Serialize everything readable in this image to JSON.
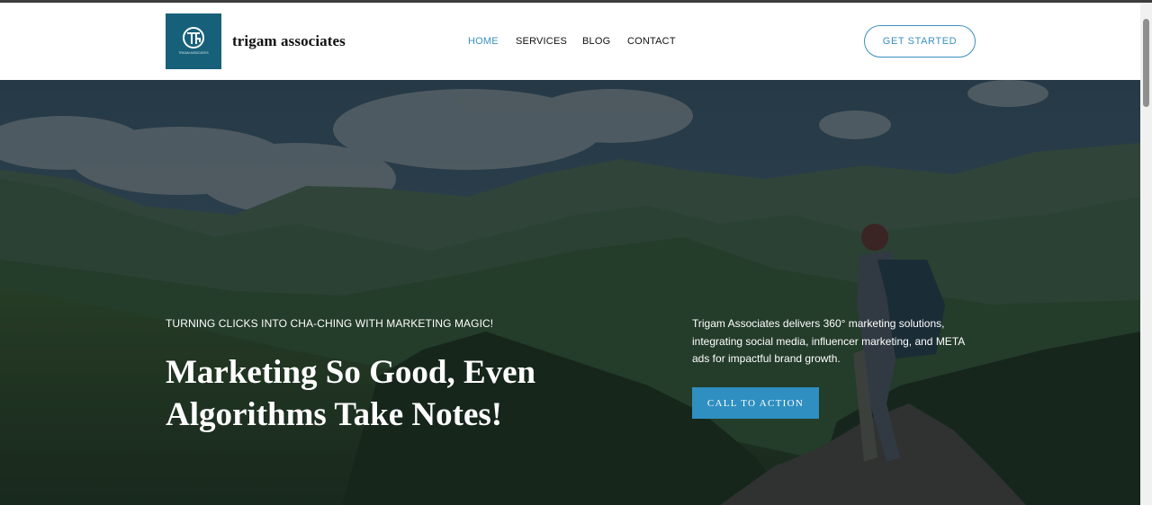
{
  "brand": {
    "name": "trigam associates",
    "logo_caption": "TRIGAM ASSOCIATES",
    "logo_color": "#17607a"
  },
  "nav": {
    "items": [
      {
        "label": "HOME",
        "active": true
      },
      {
        "label": "SERVICES",
        "active": false
      },
      {
        "label": "BLOG",
        "active": false
      },
      {
        "label": "CONTACT",
        "active": false
      }
    ],
    "active_color": "#3b8fbf"
  },
  "header": {
    "cta_label": "GET STARTED"
  },
  "hero": {
    "tagline": "TURNING CLICKS INTO CHA-CHING WITH MARKETING MAGIC!",
    "headline": "Marketing So Good, Even Algorithms Take Notes!",
    "description": "Trigam Associates delivers 360° marketing solutions, integrating social media, influencer marketing, and META ads for impactful brand growth.",
    "cta_label": "CALL TO ACTION",
    "cta_color": "#2f8fc1",
    "background": "mountain-landscape-hiker-photo"
  }
}
